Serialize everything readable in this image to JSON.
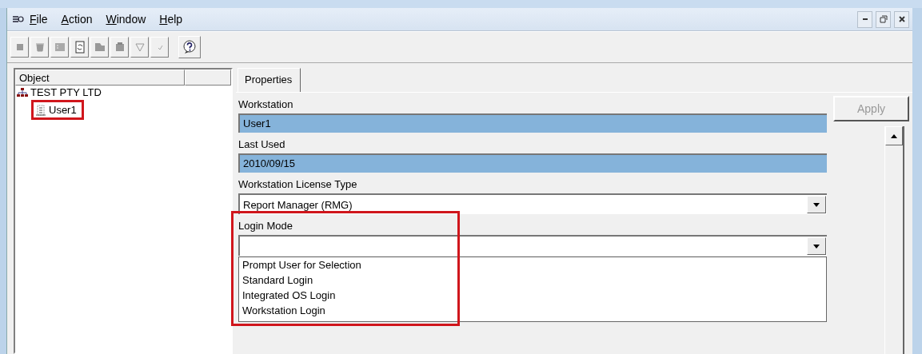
{
  "menu": [
    {
      "label": "File"
    },
    {
      "label": "Action"
    },
    {
      "label": "Window"
    },
    {
      "label": "Help"
    }
  ],
  "tree": {
    "column": "Object",
    "items": [
      {
        "label": "TEST PTY LTD",
        "kind": "org",
        "children": [
          {
            "label": "User1",
            "kind": "workstation",
            "highlighted": true
          }
        ]
      }
    ]
  },
  "tabs": [
    {
      "label": "Properties",
      "selected": true
    }
  ],
  "apply_button": {
    "label": "Apply",
    "disabled": true
  },
  "fields": [
    {
      "kind": "text",
      "label": "Workstation",
      "value": "User1"
    },
    {
      "kind": "text",
      "label": "Last Used",
      "value": "2010/09/15"
    },
    {
      "kind": "dropdown",
      "label": "Workstation License Type",
      "value": "Report Manager (RMG)"
    },
    {
      "kind": "dropdown",
      "label": "Login Mode",
      "expanded": true,
      "highlighted": true,
      "options": [
        "Prompt User for Selection",
        "Standard Login",
        "Integrated OS Login",
        "Workstation Login"
      ]
    }
  ]
}
